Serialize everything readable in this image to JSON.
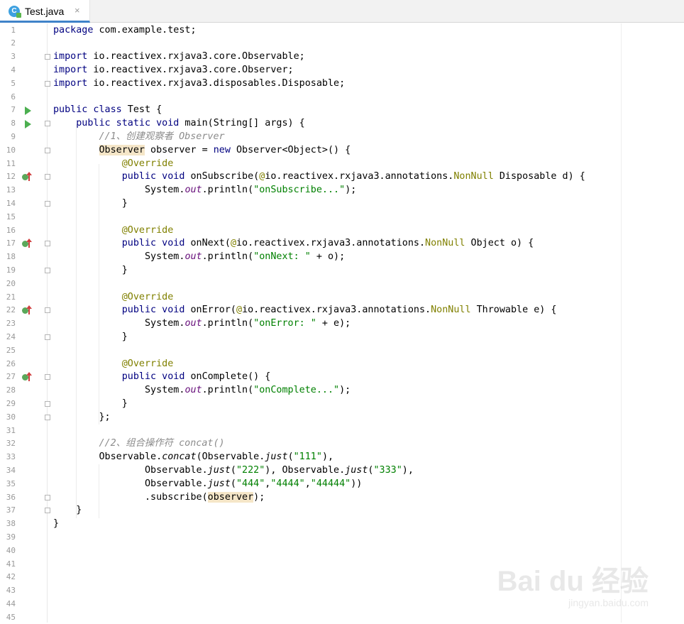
{
  "tab": {
    "label": "Test.java",
    "icon": "java-class-icon",
    "icon_letter": "C",
    "close": "×"
  },
  "watermark": {
    "main": "Bai du 经验",
    "sub": "jingyan.baidu.com"
  },
  "line_numbers": [
    "1",
    "2",
    "3",
    "4",
    "5",
    "6",
    "7",
    "8",
    "9",
    "10",
    "11",
    "12",
    "13",
    "14",
    "15",
    "16",
    "17",
    "18",
    "19",
    "20",
    "21",
    "22",
    "23",
    "24",
    "25",
    "26",
    "27",
    "28",
    "29",
    "30",
    "31",
    "32",
    "33",
    "34",
    "35",
    "36",
    "37",
    "38",
    "39",
    "40",
    "41",
    "42",
    "43",
    "44",
    "45"
  ],
  "code": {
    "l1": [
      "package",
      " com.example.test;"
    ],
    "l3": [
      "import",
      " io.reactivex.rxjava3.core.Observable;"
    ],
    "l4": [
      "import",
      " io.reactivex.rxjava3.core.Observer;"
    ],
    "l5": [
      "import",
      " io.reactivex.rxjava3.disposables.Disposable;"
    ],
    "l7": [
      "public class",
      " Test {"
    ],
    "l8": [
      "    ",
      "public static void",
      " main(String[] args) {"
    ],
    "l9": [
      "        ",
      "//1、创建观察者 Observer"
    ],
    "l10": [
      "        ",
      "Observer",
      " observer = ",
      "new",
      " Observer<Object>() {"
    ],
    "l11": [
      "            ",
      "@Override"
    ],
    "l12": [
      "            ",
      "public void",
      " onSubscribe(",
      "@",
      "io.reactivex.rxjava3.annotations.",
      "NonNull",
      " Disposable d) {"
    ],
    "l13": [
      "                System.",
      "out",
      ".println(",
      "\"onSubscribe...\"",
      ");"
    ],
    "l14": [
      "            }"
    ],
    "l16": [
      "            ",
      "@Override"
    ],
    "l17": [
      "            ",
      "public void",
      " onNext(",
      "@",
      "io.reactivex.rxjava3.annotations.",
      "NonNull",
      " Object o) {"
    ],
    "l18": [
      "                System.",
      "out",
      ".println(",
      "\"onNext: \"",
      " + o);"
    ],
    "l19": [
      "            }"
    ],
    "l21": [
      "            ",
      "@Override"
    ],
    "l22": [
      "            ",
      "public void",
      " onError(",
      "@",
      "io.reactivex.rxjava3.annotations.",
      "NonNull",
      " Throwable e) {"
    ],
    "l23": [
      "                System.",
      "out",
      ".println(",
      "\"onError: \"",
      " + e);"
    ],
    "l24": [
      "            }"
    ],
    "l26": [
      "            ",
      "@Override"
    ],
    "l27": [
      "            ",
      "public void",
      " onComplete() {"
    ],
    "l28": [
      "                System.",
      "out",
      ".println(",
      "\"onComplete...\"",
      ");"
    ],
    "l29": [
      "            }"
    ],
    "l30": [
      "        };"
    ],
    "l32": [
      "        ",
      "//2、组合操作符 concat()"
    ],
    "l33": [
      "        Observable.",
      "concat",
      "(Observable.",
      "just",
      "(",
      "\"111\"",
      "),"
    ],
    "l34": [
      "                Observable.",
      "just",
      "(",
      "\"222\"",
      "), Observable.",
      "just",
      "(",
      "\"333\"",
      "),"
    ],
    "l35": [
      "                Observable.",
      "just",
      "(",
      "\"444\"",
      ",",
      "\"4444\"",
      ",",
      "\"44444\"",
      "))"
    ],
    "l36": [
      "                .subscribe(",
      "observer",
      ");"
    ],
    "l37": [
      "    }"
    ],
    "l38": [
      "}"
    ]
  }
}
